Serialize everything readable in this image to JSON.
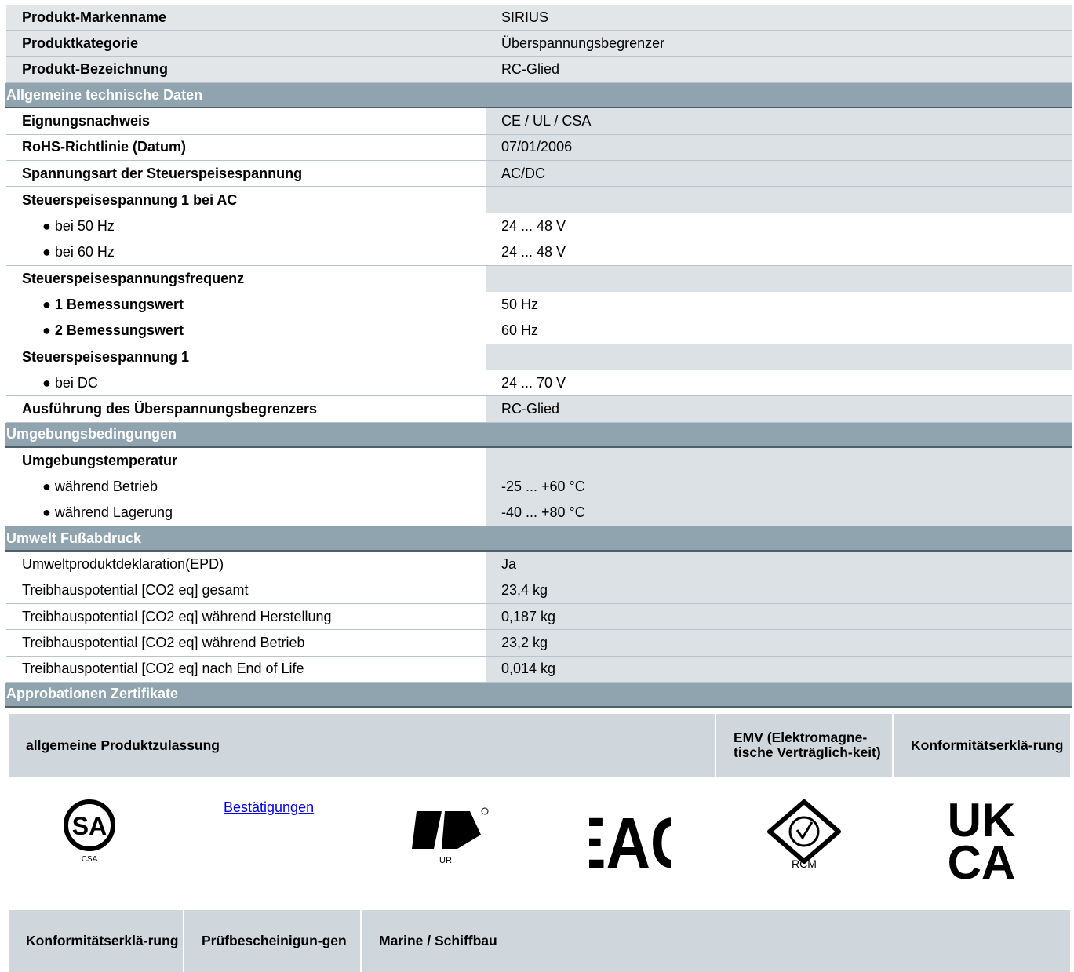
{
  "top": [
    {
      "label": "Produkt-Markenname",
      "value": "SIRIUS"
    },
    {
      "label": "Produktkategorie",
      "value": "Überspannungsbegrenzer"
    },
    {
      "label": "Produkt-Bezeichnung",
      "value": "RC-Glied"
    }
  ],
  "sec_general": "Allgemeine technische Daten",
  "general": {
    "eignung": {
      "label": "Eignungsnachweis",
      "value": "CE / UL / CSA"
    },
    "rohs": {
      "label": "RoHS-Richtlinie (Datum)",
      "value": "07/01/2006"
    },
    "spannungsart": {
      "label": "Spannungsart der Steuerspeisespannung",
      "value": "AC/DC"
    },
    "ac_group": "Steuerspeisespannung 1 bei AC",
    "ac50": {
      "label": "● bei 50 Hz",
      "value": "24 ... 48 V"
    },
    "ac60": {
      "label": "● bei 60 Hz",
      "value": "24 ... 48 V"
    },
    "freq_group": "Steuerspeisespannungsfrequenz",
    "freq1": {
      "label": "● 1 Bemessungswert",
      "value": "50 Hz"
    },
    "freq2": {
      "label": "● 2 Bemessungswert",
      "value": "60 Hz"
    },
    "dc_group": "Steuerspeisespannung 1",
    "dc": {
      "label": "● bei DC",
      "value": "24 ... 70 V"
    },
    "ausfuehrung": {
      "label": "Ausführung des Überspannungsbegrenzers",
      "value": "RC-Glied"
    }
  },
  "sec_env": "Umgebungsbedingungen",
  "env": {
    "group": "Umgebungstemperatur",
    "betrieb": {
      "label": "● während Betrieb",
      "value": "-25 ... +60 °C"
    },
    "lagerung": {
      "label": "● während Lagerung",
      "value": "-40 ... +80 °C"
    }
  },
  "sec_foot": "Umwelt Fußabdruck",
  "foot": [
    {
      "label": "Umweltproduktdeklaration(EPD)",
      "value": "Ja"
    },
    {
      "label": "Treibhauspotential [CO2 eq] gesamt",
      "value": "23,4 kg"
    },
    {
      "label": "Treibhauspotential [CO2 eq] während Herstellung",
      "value": "0,187 kg"
    },
    {
      "label": "Treibhauspotential [CO2 eq] während Betrieb",
      "value": "23,2 kg"
    },
    {
      "label": "Treibhauspotential [CO2 eq] nach End of Life",
      "value": "0,014 kg"
    }
  ],
  "sec_cert": "Approbationen Zertifikate",
  "cert_head": {
    "general": "allgemeine Produktzulassung",
    "emv": "EMV (Elektromagne-tische Verträglich-keit)",
    "konf": "Konformitätserklä-rung"
  },
  "cert_link": "Bestätigungen",
  "logos": {
    "csa": "CSA",
    "ur": "UR",
    "eac": "EAC",
    "rcm": "RCM",
    "ukca_1": "UK",
    "ukca_2": "CA"
  },
  "cert_head2": {
    "konf": "Konformitätserklä-rung",
    "pruef": "Prüfbescheinigun-gen",
    "marine": "Marine / Schiffbau"
  }
}
